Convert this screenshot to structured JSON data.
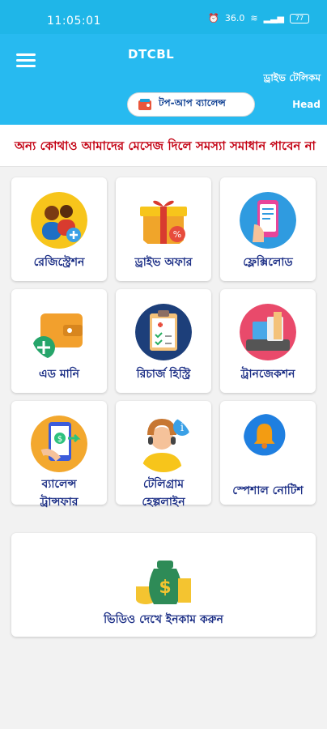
{
  "status": {
    "time": "11:05:01",
    "network_speed": "36.0",
    "battery": "77"
  },
  "header": {
    "title": "DTCBL",
    "operator_label": "ড্রাইভ টেলিকম",
    "topup_label": "টপ-আপ ব্যালেন্স",
    "head_label": "Head"
  },
  "notice": {
    "text": "অন্য কোথাও আমাদের মেসেজ দিলে  সমস্যা সমাধান পাবেন না"
  },
  "tiles": [
    {
      "label": "রেজিস্ট্রেশন"
    },
    {
      "label": "ড্রাইভ অফার"
    },
    {
      "label": "ফ্লেক্সিলোড"
    },
    {
      "label": "এড মানি"
    },
    {
      "label": "রিচার্জ হিস্ট্রি"
    },
    {
      "label": "ট্রানজেকশন"
    },
    {
      "label": "ব্যালেন্স\nট্রান্সফার"
    },
    {
      "label": "টেলিগ্রাম\nহেল্পলাইন"
    },
    {
      "label": "স্পেশাল নোটিশ"
    }
  ],
  "wide": {
    "label": "ভিডিও দেখে ইনকাম করুন"
  },
  "colors": {
    "primary": "#27baf0",
    "label": "#1c2f86",
    "notice": "#c30012"
  }
}
